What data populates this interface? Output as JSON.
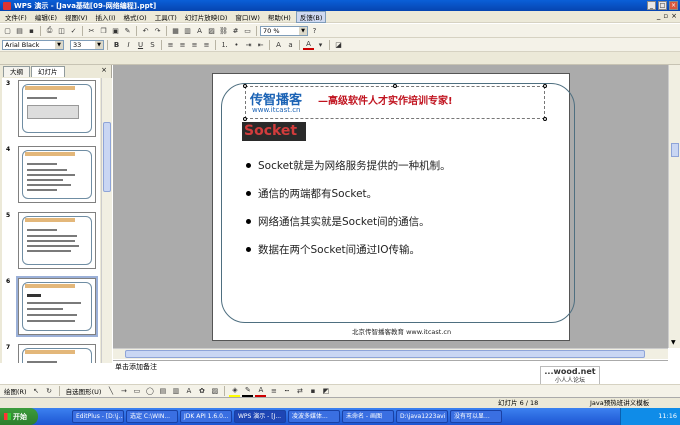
{
  "window": {
    "title": "WPS 演示 - [Java基础[09-网络编程].ppt]"
  },
  "menu": [
    "文件(F)",
    "编辑(E)",
    "视图(V)",
    "插入(I)",
    "格式(O)",
    "工具(T)",
    "幻灯片放映(D)",
    "窗口(W)",
    "帮助(H)",
    "反馈(B)"
  ],
  "toolbar": {
    "zoom": "70 %",
    "font_name": "Arial Black",
    "font_size": "33"
  },
  "panel": {
    "tab_outline": "大纲",
    "tab_slides": "幻灯片",
    "thumb_numbers": [
      "3",
      "4",
      "5",
      "6",
      "7"
    ]
  },
  "slide": {
    "logo_cn": "传智播客",
    "logo_url": "www.itcast.cn",
    "slogan": "—高级软件人才实作培训专家!",
    "title": "Socket",
    "bullets": [
      "Socket就是为网络服务提供的一种机制。",
      "通信的两端都有Socket。",
      "网络通信其实就是Socket间的通信。",
      "数据在两个Socket间通过IO传输。"
    ],
    "footer": "北京传智播客教育 www.itcast.cn"
  },
  "notes": {
    "placeholder": "单击添加备注"
  },
  "drawbar": {
    "draw_label": "绘图(R)",
    "autoshape_label": "自选图形(U)"
  },
  "status": {
    "slide_counter": "幻灯片 6 / 18",
    "template": "Java预热班讲义模板"
  },
  "ad": {
    "brand": "...wood.net",
    "sub": "小人人论坛"
  },
  "taskbar": {
    "start": "开始",
    "items": [
      "EditPlus - [D:\\j...",
      "选定 C:\\WIN...",
      "JDK API 1.6.0...",
      "WPS 演示 - [J...",
      "凌波多媒体...",
      "未命名 - 画图",
      "D:\\java1223avi",
      "没有可以显..."
    ],
    "clock": "11:16"
  },
  "colors": {
    "brand_blue": "#1b63b5",
    "slogan_red": "#c0121e",
    "titlebar": "#0a5fd8"
  }
}
